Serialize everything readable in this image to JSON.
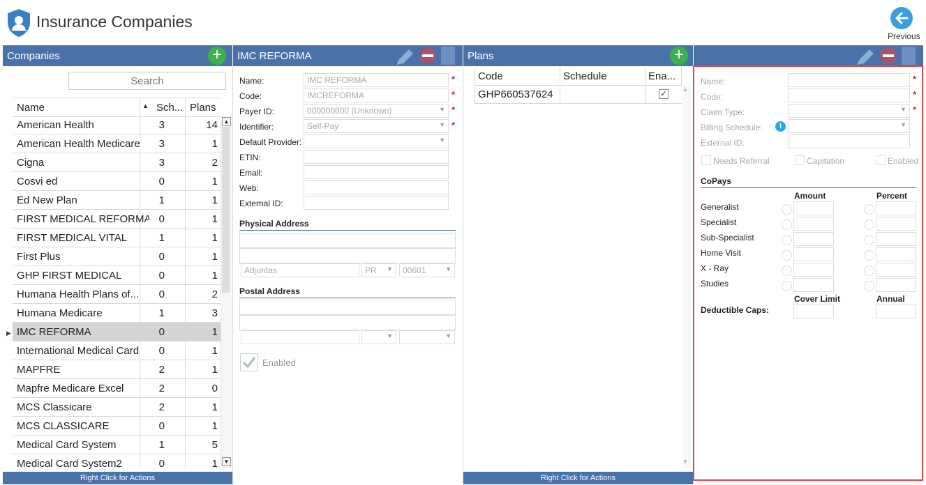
{
  "app": {
    "title": "Insurance Companies",
    "previous_label": "Previous"
  },
  "companies": {
    "header": "Companies",
    "search_placeholder": "Search",
    "columns": {
      "name": "Name",
      "schedules": "Sch...",
      "plans": "Plans"
    },
    "rows": [
      {
        "name": "American Health",
        "sch": "3",
        "plans": "14"
      },
      {
        "name": "American Health Medicare",
        "sch": "3",
        "plans": "1"
      },
      {
        "name": "Cigna",
        "sch": "3",
        "plans": "2"
      },
      {
        "name": "Cosvi ed",
        "sch": "0",
        "plans": "1"
      },
      {
        "name": "Ed New Plan",
        "sch": "1",
        "plans": "1"
      },
      {
        "name": "FIRST MEDICAL REFORMA",
        "sch": "0",
        "plans": "1"
      },
      {
        "name": "FIRST MEDICAL VITAL",
        "sch": "1",
        "plans": "1"
      },
      {
        "name": "First Plus",
        "sch": "0",
        "plans": "1"
      },
      {
        "name": "GHP FIRST MEDICAL",
        "sch": "0",
        "plans": "1"
      },
      {
        "name": "Humana Health Plans of...",
        "sch": "0",
        "plans": "2"
      },
      {
        "name": "Humana Medicare",
        "sch": "1",
        "plans": "3"
      },
      {
        "name": "IMC REFORMA",
        "sch": "0",
        "plans": "1"
      },
      {
        "name": "International Medical Card",
        "sch": "0",
        "plans": "1"
      },
      {
        "name": "MAPFRE",
        "sch": "2",
        "plans": "1"
      },
      {
        "name": "Mapfre Medicare Excel",
        "sch": "2",
        "plans": "0"
      },
      {
        "name": "MCS Classicare",
        "sch": "2",
        "plans": "1"
      },
      {
        "name": "MCS CLASSICARE",
        "sch": "0",
        "plans": "1"
      },
      {
        "name": "Medical Card System",
        "sch": "1",
        "plans": "5"
      },
      {
        "name": "Medical Card System2",
        "sch": "0",
        "plans": "1"
      }
    ],
    "footer": "Right Click for Actions"
  },
  "detail": {
    "header": "IMC REFORMA",
    "labels": {
      "name": "Name:",
      "code": "Code:",
      "payer_id": "Payer ID:",
      "identifier": "Identifier:",
      "default_provider": "Default Provider:",
      "etin": "ETIN:",
      "email": "Email:",
      "web": "Web:",
      "external_id": "External ID:"
    },
    "values": {
      "name": "IMC REFORMA",
      "code": "IMCREFORMA",
      "payer_id": "000000000 (Unknown)",
      "identifier": "Self-Pay"
    },
    "physical_address": {
      "title": "Physical Address",
      "city": "Adjuntas",
      "state": "PR",
      "zip": "00601"
    },
    "postal_address": {
      "title": "Postal Address"
    },
    "enabled_label": "Enabled"
  },
  "plans": {
    "header": "Plans",
    "columns": {
      "code": "Code",
      "schedule": "Schedule",
      "enabled": "Ena..."
    },
    "rows": [
      {
        "code": "GHP660537624",
        "schedule": ""
      }
    ],
    "footer": "Right Click for Actions"
  },
  "plan_detail": {
    "labels": {
      "name": "Name:",
      "code": "Code:",
      "claim_type": "Claim Type:",
      "billing_schedule": "Billing Schedule:",
      "external_id": "External ID:"
    },
    "checks": {
      "needs_referral": "Needs Referral",
      "capitation": "Capitation",
      "enabled": "Enabled"
    },
    "copays": {
      "title": "CoPays",
      "amount": "Amount",
      "percent": "Percent",
      "rows": [
        "Generalist",
        "Specialist",
        "Sub-Specialist",
        "Home Visit",
        "X - Ray",
        "Studies"
      ],
      "cover_limit": "Cover Limit",
      "annual": "Annual",
      "deductible_caps": "Deductible Caps:"
    },
    "highlight_color": "#e04848"
  }
}
